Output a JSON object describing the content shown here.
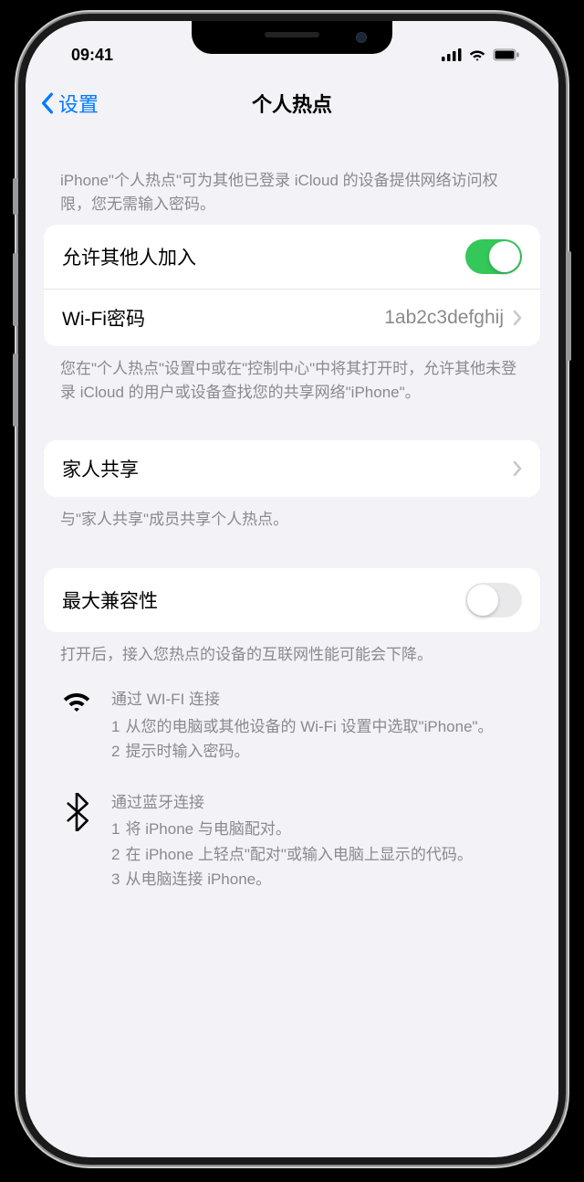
{
  "status": {
    "time": "09:41"
  },
  "nav": {
    "back_label": "设置",
    "title": "个人热点"
  },
  "header_desc": "iPhone\"个人热点\"可为其他已登录 iCloud 的设备提供网络访问权限，您无需输入密码。",
  "allow_others": {
    "label": "允许其他人加入",
    "on": true
  },
  "wifi_password": {
    "label": "Wi-Fi密码",
    "value": "1ab2c3defghij"
  },
  "allow_footer": "您在\"个人热点\"设置中或在\"控制中心\"中将其打开时，允许其他未登录 iCloud 的用户或设备查找您的共享网络\"iPhone\"。",
  "family_sharing": {
    "label": "家人共享"
  },
  "family_footer": "与\"家人共享\"成员共享个人热点。",
  "max_compat": {
    "label": "最大兼容性",
    "on": false
  },
  "max_compat_footer": "打开后，接入您热点的设备的互联网性能可能会下降。",
  "instructions": {
    "wifi": {
      "title": "通过 WI-FI 连接",
      "steps": [
        "从您的电脑或其他设备的 Wi-Fi 设置中选取\"iPhone\"。",
        "提示时输入密码。"
      ]
    },
    "bluetooth": {
      "title": "通过蓝牙连接",
      "steps": [
        "将 iPhone 与电脑配对。",
        "在 iPhone 上轻点\"配对\"或输入电脑上显示的代码。",
        "从电脑连接 iPhone。"
      ]
    }
  }
}
